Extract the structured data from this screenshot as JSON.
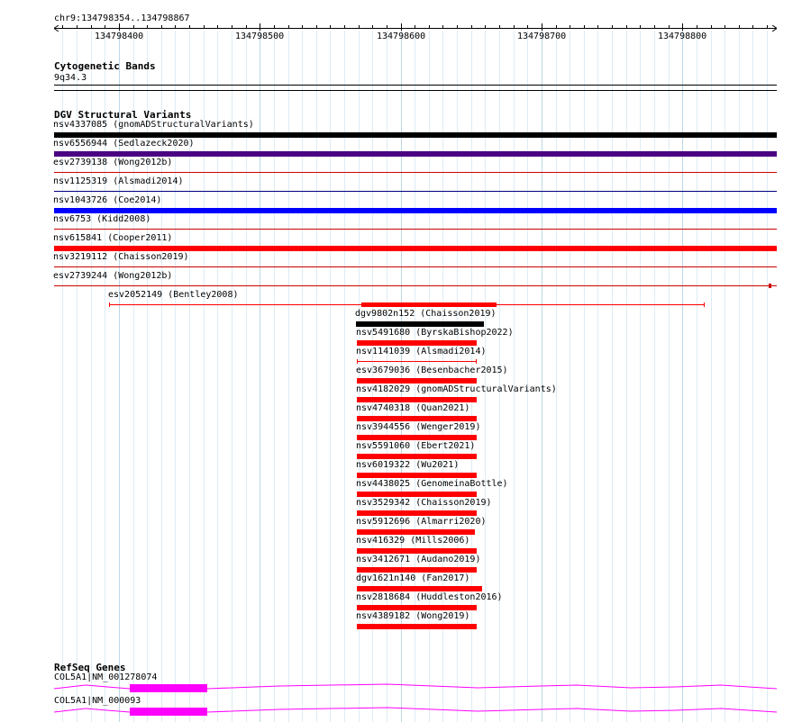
{
  "ruler": {
    "range_label": "chr9:134798354..134798867",
    "start": 134798354,
    "end": 134798867,
    "ticks": [
      134798400,
      134798500,
      134798600,
      134798700,
      134798800
    ]
  },
  "cytobands": {
    "title": "Cytogenetic Bands",
    "band": "9q34.3"
  },
  "dgv": {
    "title": "DGV Structural Variants",
    "variants": [
      {
        "label": "nsv4337085 (gnomADStructuralVariants)",
        "start": 134798354,
        "end": 134798867,
        "color": "#000000",
        "style": "thick"
      },
      {
        "label": "nsv6556944 (Sedlazeck2020)",
        "start": 134798354,
        "end": 134798867,
        "color": "#4b0082",
        "style": "thick"
      },
      {
        "label": "esv2739138 (Wong2012b)",
        "start": 134798354,
        "end": 134798867,
        "color": "#cc0000",
        "style": "thin"
      },
      {
        "label": "nsv1125319 (Alsmadi2014)",
        "start": 134798354,
        "end": 134798867,
        "color": "#000080",
        "style": "thin"
      },
      {
        "label": "nsv1043726 (Coe2014)",
        "start": 134798354,
        "end": 134798867,
        "color": "#0000ff",
        "style": "thick"
      },
      {
        "label": "nsv6753 (Kidd2008)",
        "start": 134798354,
        "end": 134798867,
        "color": "#cc0000",
        "style": "thin"
      },
      {
        "label": "nsv615841 (Cooper2011)",
        "start": 134798354,
        "end": 134798867,
        "color": "#ff0000",
        "style": "thick"
      },
      {
        "label": "nsv3219112 (Chaisson2019)",
        "start": 134798354,
        "end": 134798867,
        "color": "#cc0000",
        "style": "thin"
      },
      {
        "label": "esv2739244 (Wong2012b)",
        "start": 134798354,
        "end": 134798867,
        "color": "#cc0000",
        "style": "thin-end"
      },
      {
        "label": "esv2052149 (Bentley2008)",
        "start": 134798393,
        "end": 134798816,
        "color": "#ff0000",
        "style": "thin-ends",
        "thick_start": 134798572,
        "thick_end": 134798668
      },
      {
        "label": "dgv9802n152 (Chaisson2019)",
        "start": 134798568,
        "end": 134798659,
        "color": "#000000",
        "style": "thick"
      },
      {
        "label": "nsv5491680 (ByrskaBishop2022)",
        "start": 134798569,
        "end": 134798654,
        "color": "#ff0000",
        "style": "thick"
      },
      {
        "label": "nsv1141039 (Alsmadi2014)",
        "start": 134798569,
        "end": 134798654,
        "color": "#ff0000",
        "style": "thin-ends"
      },
      {
        "label": "esv3679036 (Besenbacher2015)",
        "start": 134798569,
        "end": 134798654,
        "color": "#ff0000",
        "style": "thick"
      },
      {
        "label": "nsv4182029 (gnomADStructuralVariants)",
        "start": 134798569,
        "end": 134798654,
        "color": "#ff0000",
        "style": "thick"
      },
      {
        "label": "nsv4740318 (Quan2021)",
        "start": 134798569,
        "end": 134798654,
        "color": "#ff0000",
        "style": "thick"
      },
      {
        "label": "nsv3944556 (Wenger2019)",
        "start": 134798569,
        "end": 134798654,
        "color": "#ff0000",
        "style": "thick"
      },
      {
        "label": "nsv5591060 (Ebert2021)",
        "start": 134798569,
        "end": 134798654,
        "color": "#ff0000",
        "style": "thick"
      },
      {
        "label": "nsv6019322 (Wu2021)",
        "start": 134798569,
        "end": 134798654,
        "color": "#ff0000",
        "style": "thick"
      },
      {
        "label": "nsv4438025 (GenomeinaBottle)",
        "start": 134798569,
        "end": 134798654,
        "color": "#ff0000",
        "style": "thick"
      },
      {
        "label": "nsv3529342 (Chaisson2019)",
        "start": 134798569,
        "end": 134798654,
        "color": "#ff0000",
        "style": "thick"
      },
      {
        "label": "nsv5912696 (Almarri2020)",
        "start": 134798569,
        "end": 134798653,
        "color": "#ff0000",
        "style": "thick"
      },
      {
        "label": "nsv416329 (Mills2006)",
        "start": 134798569,
        "end": 134798654,
        "color": "#ff0000",
        "style": "thick"
      },
      {
        "label": "nsv3412671 (Audano2019)",
        "start": 134798569,
        "end": 134798654,
        "color": "#ff0000",
        "style": "thick"
      },
      {
        "label": "dgv1621n140 (Fan2017)",
        "start": 134798569,
        "end": 134798658,
        "color": "#ff0000",
        "style": "thick"
      },
      {
        "label": "nsv2818684 (Huddleston2016)",
        "start": 134798569,
        "end": 134798654,
        "color": "#ff0000",
        "style": "thick"
      },
      {
        "label": "nsv4389182 (Wong2019)",
        "start": 134798569,
        "end": 134798654,
        "color": "#ff0000",
        "style": "thick"
      }
    ]
  },
  "refseq": {
    "title": "RefSeq Genes",
    "genes": [
      {
        "label": "COL5A1|NM_001278074",
        "color": "#ff00ff"
      },
      {
        "label": "COL5A1|NM_000093",
        "color": "#ff00ff"
      }
    ]
  }
}
